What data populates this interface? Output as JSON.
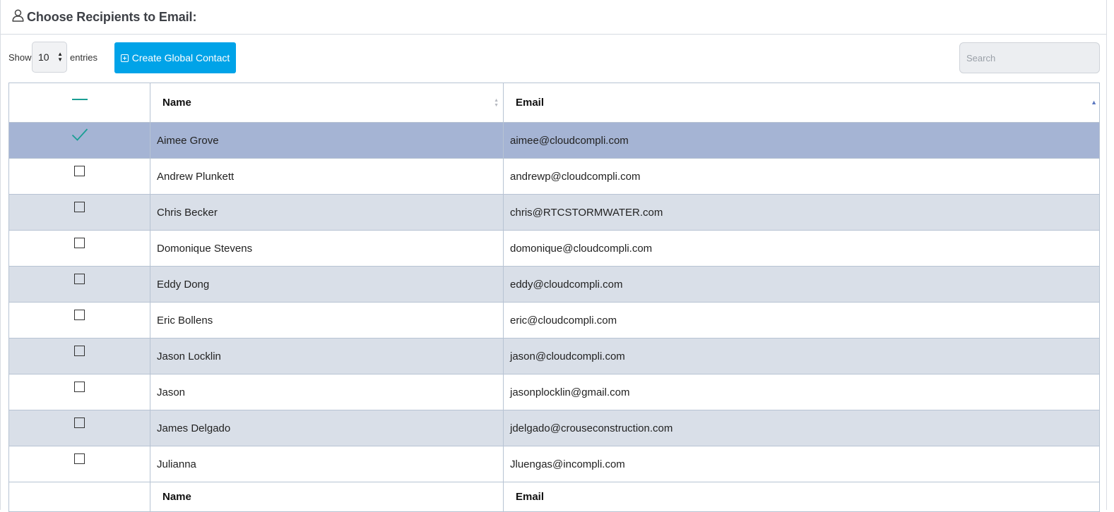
{
  "header": {
    "title": "Choose Recipients to Email:"
  },
  "toolbar": {
    "show_label": "Show",
    "page_length": "10",
    "entries_label": "entries",
    "create_button_label": "Create Global Contact",
    "search_placeholder": "Search"
  },
  "table": {
    "columns": [
      "Name",
      "Email"
    ],
    "rows": [
      {
        "name": "Aimee Grove",
        "email": "aimee@cloudcompli.com",
        "selected": true
      },
      {
        "name": "Andrew Plunkett",
        "email": "andrewp@cloudcompli.com",
        "selected": false
      },
      {
        "name": "Chris Becker",
        "email": "chris@RTCSTORMWATER.com",
        "selected": false
      },
      {
        "name": "Domonique Stevens",
        "email": "domonique@cloudcompli.com",
        "selected": false
      },
      {
        "name": "Eddy Dong",
        "email": "eddy@cloudcompli.com",
        "selected": false
      },
      {
        "name": "Eric Bollens",
        "email": "eric@cloudcompli.com",
        "selected": false
      },
      {
        "name": "Jason Locklin",
        "email": "jason@cloudcompli.com",
        "selected": false
      },
      {
        "name": "Jason",
        "email": "jasonplocklin@gmail.com",
        "selected": false
      },
      {
        "name": "James Delgado",
        "email": "jdelgado@crouseconstruction.com",
        "selected": false
      },
      {
        "name": "Julianna",
        "email": "Jluengas@incompli.com",
        "selected": false
      }
    ],
    "footer_columns": [
      "Name",
      "Email"
    ]
  },
  "colors": {
    "accent_button": "#00a3e8",
    "selected_row": "#a5b4d4",
    "striped_row": "#d9dfe8",
    "check_teal": "#1a9e94"
  }
}
